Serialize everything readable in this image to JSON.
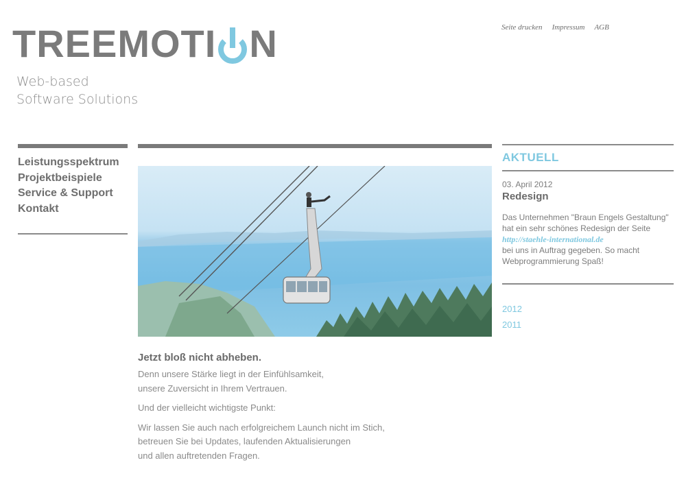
{
  "brand": {
    "logo_text_left": "TREEMOTI",
    "logo_text_right": "N",
    "tagline_line1": "Web-based",
    "tagline_line2": "Software Solutions",
    "logo_color": "#7b7b7b",
    "power_color": "#7fc8e0"
  },
  "toplinks": [
    "Seite drucken",
    "Impressum",
    "AGB"
  ],
  "nav": {
    "items": [
      "Leistungsspektrum",
      "Projektbeispiele",
      "Service & Support",
      "Kontakt"
    ]
  },
  "main": {
    "heading": "Jetzt bloß nicht abheben.",
    "para1_line1": "Denn unsere Stärke liegt in der Einfühlsamkeit,",
    "para1_line2": "unsere Zuversicht in Ihrem Vertrauen.",
    "para2": "Und der vielleicht wichtigste Punkt:",
    "para3_line1": "Wir lassen Sie auch nach erfolgreichem Launch nicht im Stich,",
    "para3_line2": "betreuen Sie bei Updates, laufenden Aktualisierungen",
    "para3_line3": "und allen auftretenden Fragen."
  },
  "news": {
    "section_title": "AKTUELL",
    "date": "03. April 2012",
    "title": "Redesign",
    "body_before": "Das Unternehmen \"Braun Engels Gestaltung\" hat ein sehr schönes Redesign der Seite",
    "link": "http://staehle-international.de",
    "body_after": "bei uns in Auftrag gegeben. So macht Webprogrammierung Spaß!",
    "archive": [
      "2012",
      "2011"
    ]
  },
  "colors": {
    "accent": "#7fc8e0",
    "text": "#6f6f6f",
    "bar": "#7a7a7a"
  }
}
